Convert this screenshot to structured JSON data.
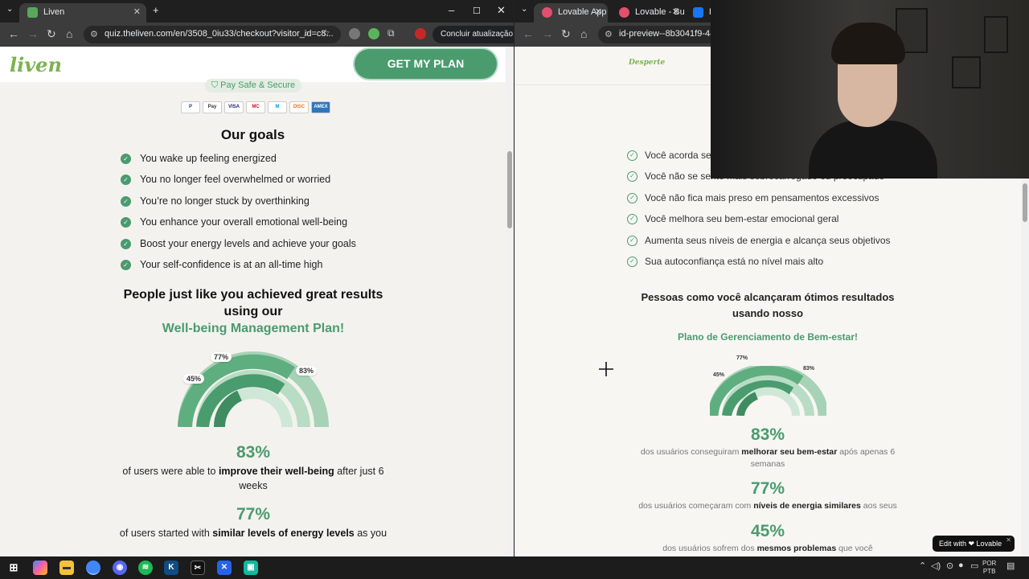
{
  "left": {
    "tab_title": "Liven",
    "url": "quiz.theliven.com/en/3508_0iu33/checkout?visitor_id=c8...",
    "update_button": "Concluir atualização",
    "logo": "liven",
    "cta": "GET MY PLAN",
    "pay_badge": "Pay Safe & Secure",
    "payment_cards": [
      "P",
      "Pay",
      "VISA",
      "MC",
      "M",
      "DISC",
      "AMEX"
    ],
    "goals_title": "Our goals",
    "goals": [
      "You wake up feeling energized",
      "You no longer feel overwhelmed or worried",
      "You’re no longer stuck by overthinking",
      "You enhance your overall emotional well-being",
      "Boost your energy levels and achieve your goals",
      "Your self-confidence is at an all-time high"
    ],
    "results_heading_line1": "People just like you achieved great results",
    "results_heading_line2": "using our",
    "results_heading_green": "Well-being Management Plan!",
    "chart_labels": {
      "a": "77%",
      "b": "83%",
      "c": "45%"
    },
    "stats": [
      {
        "num": "83%",
        "pre": "of users were able to ",
        "bold": "improve their well-being",
        "post": " after just 6 weeks"
      },
      {
        "num": "77%",
        "pre": "of users started with ",
        "bold": "similar levels of energy levels",
        "post": " as you"
      }
    ]
  },
  "right": {
    "tabs": [
      "Lovable App",
      "Lovable - Bu",
      "Bi"
    ],
    "url": "id-preview--8b3041f9-44ba-",
    "logo": "Desperte",
    "goals": [
      "Você acorda se",
      "Você não se sente mais sobrecarregado ou preocupado",
      "Você não fica mais preso em pensamentos excessivos",
      "Você melhora seu bem-estar emocional geral",
      "Aumenta seus níveis de energia e alcança seus objetivos",
      "Sua autoconfiança está no nível mais alto"
    ],
    "results_heading_line1": "Pessoas como você alcançaram ótimos resultados",
    "results_heading_line2": "usando nosso",
    "results_heading_green": "Plano de Gerenciamento de Bem-estar!",
    "chart_labels": {
      "a": "77%",
      "b": "83%",
      "c": "45%"
    },
    "stats": [
      {
        "num": "83%",
        "pre": "dos usuários conseguiram ",
        "bold": "melhorar seu bem-estar",
        "post": " após apenas 6 semanas"
      },
      {
        "num": "77%",
        "pre": "dos usuários começaram com ",
        "bold": "níveis de energia similares",
        "post": " aos seus"
      },
      {
        "num": "45%",
        "pre": "dos usuários sofrem dos ",
        "bold": "mesmos problemas",
        "post": " que você"
      }
    ],
    "edit_badge": "Edit with ❤ Lovable"
  },
  "taskbar": {
    "lang_line1": "POR",
    "lang_line2": "PTB"
  },
  "colors": {
    "brand_green": "#4a9b6e",
    "logo_green": "#7ab34e"
  }
}
